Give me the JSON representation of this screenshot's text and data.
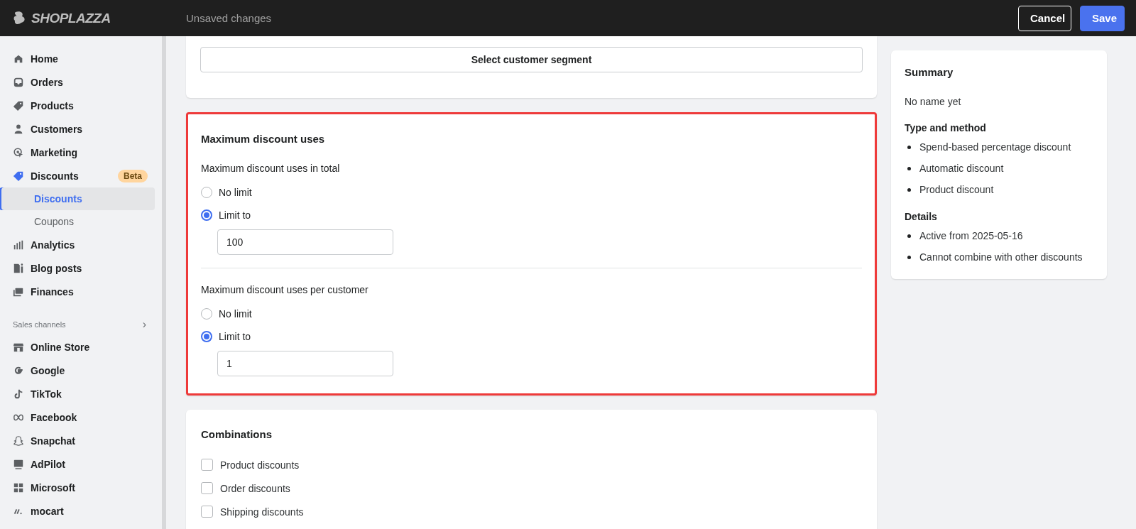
{
  "topbar": {
    "logo": "SHOPLAZZA",
    "title": "Unsaved changes",
    "buttons": [
      {
        "label": "Cancel",
        "kind": "secondary"
      },
      {
        "label": "Save",
        "kind": "primary"
      }
    ]
  },
  "sidebar": {
    "items": [
      {
        "label": "Home",
        "selected": false
      },
      {
        "label": "Orders",
        "selected": false
      },
      {
        "label": "Products",
        "selected": false
      },
      {
        "label": "Customers",
        "selected": false
      },
      {
        "label": "Marketing",
        "selected": false
      },
      {
        "label": "Discounts",
        "selected": false,
        "badge": "Beta",
        "children": [
          {
            "label": "Discounts",
            "selected": true
          },
          {
            "label": "Coupons",
            "selected": false
          }
        ]
      },
      {
        "label": "Analytics",
        "selected": false
      },
      {
        "label": "Blog posts",
        "selected": false
      },
      {
        "label": "Finances",
        "selected": false
      }
    ],
    "sales_channels": {
      "title": "Sales channels",
      "chevron": "›",
      "items": [
        {
          "label": "Online Store",
          "selected": false
        },
        {
          "label": "Google",
          "selected": false
        },
        {
          "label": "TikTok",
          "selected": false
        },
        {
          "label": "Facebook",
          "selected": false
        },
        {
          "label": "Snapchat",
          "selected": false
        },
        {
          "label": "AdPilot",
          "selected": false
        },
        {
          "label": "Microsoft",
          "selected": false
        },
        {
          "label": "mocart",
          "selected": false
        }
      ]
    }
  },
  "customer_segment_card": {
    "button": "Select customer segment"
  },
  "max_uses_card": {
    "title": "Maximum discount uses",
    "highlighted": true,
    "groups": [
      {
        "label": "Maximum discount uses in total",
        "options": [
          {
            "label": "No limit",
            "selected": false
          },
          {
            "label": "Limit to",
            "selected": true
          }
        ],
        "value": "100"
      },
      {
        "label": "Maximum discount uses per customer",
        "options": [
          {
            "label": "No limit",
            "selected": false
          },
          {
            "label": "Limit to",
            "selected": true
          }
        ],
        "value": "1"
      }
    ]
  },
  "combinations_card": {
    "title": "Combinations",
    "options": [
      {
        "label": "Product discounts",
        "checked": false
      },
      {
        "label": "Order discounts",
        "checked": false
      },
      {
        "label": "Shipping discounts",
        "checked": false
      }
    ]
  },
  "summary": {
    "title": "Summary",
    "name": "No name yet",
    "sections": [
      {
        "title": "Type and method",
        "items": [
          "Spend-based percentage discount",
          "Automatic discount",
          "Product discount"
        ]
      },
      {
        "title": "Details",
        "items": [
          "Active from 2025-05-16",
          "Cannot combine with other discounts"
        ]
      }
    ]
  }
}
